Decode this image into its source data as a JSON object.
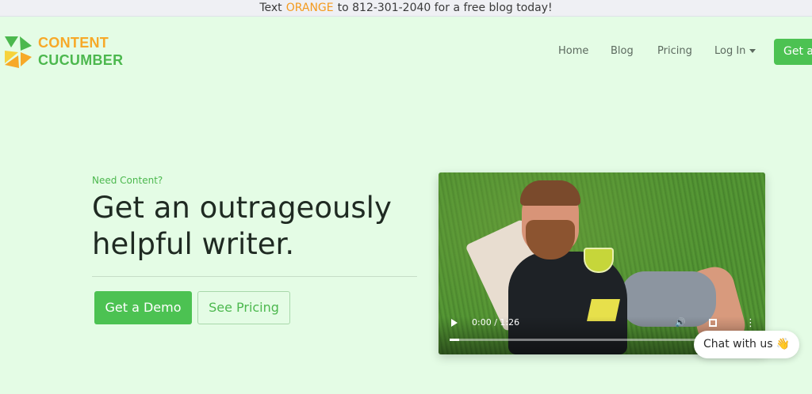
{
  "promo": {
    "before": "Text",
    "highlight": "ORANGE",
    "after": "to 812-301-2040 for a free blog today!"
  },
  "logo": {
    "line1": "CONTENT",
    "line2": "CUCUMBER",
    "colors": {
      "orange": "#f7a928",
      "green": "#4cb84e",
      "yellow": "#f6d33c"
    }
  },
  "nav": {
    "items": [
      "Home",
      "Blog",
      "Pricing",
      "Log In"
    ],
    "cta": "Get a"
  },
  "hero": {
    "eyebrow": "Need Content?",
    "headline_line1": "Get an outrageously",
    "headline_line2": "helpful writer.",
    "primary_button": "Get a Demo",
    "secondary_button": "See Pricing"
  },
  "video": {
    "time": "0:00 / 1:26",
    "progress": 0.03,
    "icons": [
      "play-icon",
      "volume-icon",
      "fullscreen-icon",
      "more-options-icon"
    ]
  },
  "chat": {
    "label": "Chat with us",
    "emoji": "👋"
  },
  "colors": {
    "background": "#e4fce5",
    "accent": "#4cc252",
    "promo_highlight": "#f39a1e"
  }
}
